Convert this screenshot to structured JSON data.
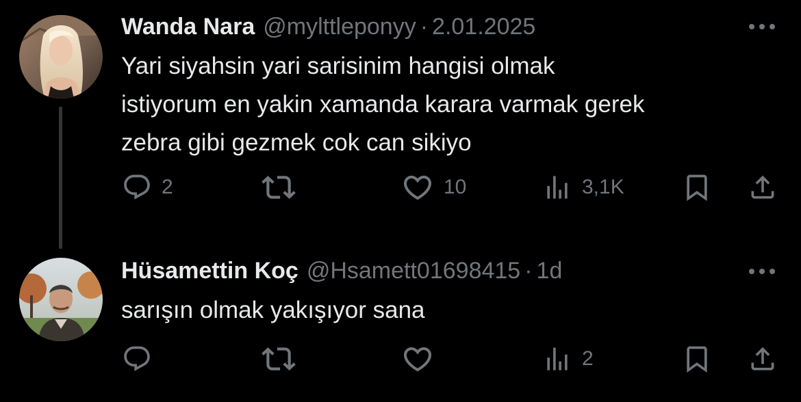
{
  "colors": {
    "background": "#000000",
    "primary_text": "#e7e9ea",
    "secondary_text": "#71767b",
    "thread_line": "#333639"
  },
  "tweets": [
    {
      "name": "Wanda Nara",
      "handle": "@mylttleponyy",
      "separator": "·",
      "time": "2.01.2025",
      "text_lines": [
        "Yari siyahsin yari sarisinim hangisi olmak",
        "istiyorum en yakin xamanda karara varmak gerek",
        "zebra gibi gezmek cok can sikiyo"
      ],
      "stats": {
        "replies": "2",
        "retweets": "",
        "likes": "10",
        "views": "3,1K"
      },
      "icons": [
        "reply-icon",
        "retweet-icon",
        "like-icon",
        "views-icon",
        "bookmark-icon",
        "share-icon",
        "more-icon"
      ]
    },
    {
      "name": "Hüsamettin Koç",
      "handle": "@Hsamett01698415",
      "separator": "·",
      "time": "1d",
      "text_lines": [
        "sarışın olmak yakışıyor sana"
      ],
      "stats": {
        "replies": "",
        "retweets": "",
        "likes": "",
        "views": "2"
      },
      "icons": [
        "reply-icon",
        "retweet-icon",
        "like-icon",
        "views-icon",
        "bookmark-icon",
        "share-icon",
        "more-icon"
      ]
    }
  ]
}
